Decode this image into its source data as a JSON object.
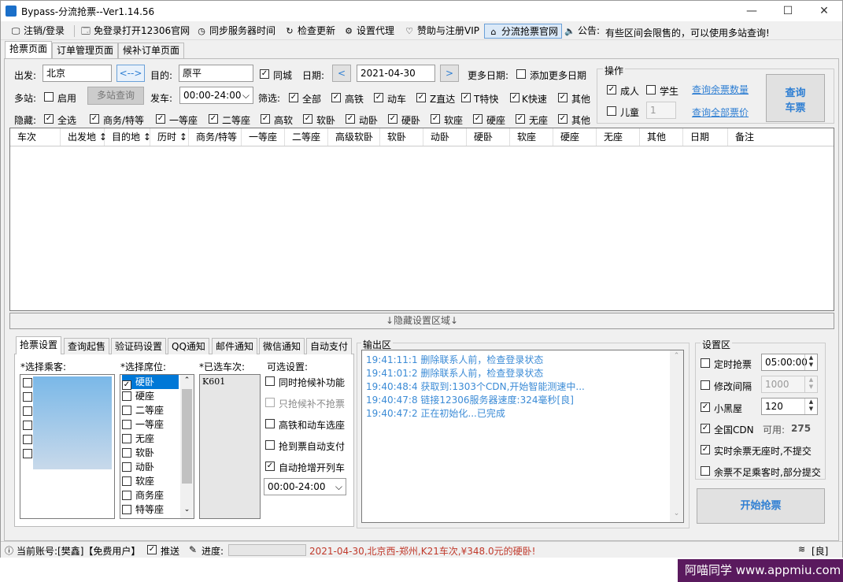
{
  "window": {
    "title": "Bypass-分流抢票--Ver1.14.56",
    "min": "—",
    "max": "☐",
    "close": "✕"
  },
  "menu": [
    {
      "label": "注销/登录",
      "icon": "🖵"
    },
    {
      "label": "免登录打开12306官网",
      "icon": "🗔"
    },
    {
      "label": "同步服务器时间",
      "icon": "◷"
    },
    {
      "label": "检查更新",
      "icon": "↻"
    },
    {
      "label": "设置代理",
      "icon": "⚙"
    },
    {
      "label": "赞助与注册VIP",
      "icon": "♡"
    },
    {
      "label": "分流抢票官网",
      "icon": "⌂"
    },
    {
      "label": "公告:",
      "icon": "🔈"
    }
  ],
  "notice": "有些区间会限售的，可以使用多站查询!",
  "tabs": [
    "抢票页面",
    "订单管理页面",
    "候补订单页面"
  ],
  "query": {
    "from_label": "出发:",
    "from": "北京",
    "swap": "<-->",
    "to_label": "目的:",
    "to": "原平",
    "same_city": "同城",
    "date_label": "日期:",
    "date": "2021-04-30",
    "prev": "<",
    "next": ">",
    "more_dates_label": "更多日期:",
    "add_more_dates": "添加更多日期",
    "multi_label": "多站:",
    "enable": "启用",
    "multi_query": "多站查询",
    "depart_label": "发车:",
    "depart_range": "00:00-24:00",
    "filter_label": "筛选:",
    "filters": [
      "全部",
      "高铁",
      "动车",
      "Z直达",
      "T特快",
      "K快速",
      "其他"
    ],
    "hide_label": "隐藏:",
    "hide_options": [
      "全选",
      "商务/特等",
      "一等座",
      "二等座",
      "高软",
      "软卧",
      "动卧",
      "硬卧",
      "软座",
      "硬座",
      "无座",
      "其他"
    ]
  },
  "ops": {
    "title": "操作",
    "adult": "成人",
    "student": "学生",
    "child": "儿童",
    "child_count": "1",
    "remain_count": "查询余票数量",
    "all_price": "查询全部票价",
    "query_btn_l1": "查询",
    "query_btn_l2": "车票"
  },
  "grid_headers": [
    "车次",
    "出发地 ↕",
    "目的地 ↕",
    "历时 ↕",
    "商务/特等",
    "一等座",
    "二等座",
    "高级软卧",
    "软卧",
    "动卧",
    "硬卧",
    "软座",
    "硬座",
    "无座",
    "其他",
    "日期",
    "备注"
  ],
  "hide_bar": "↓隐藏设置区域↓",
  "subtabs": [
    "抢票设置",
    "查询起售",
    "验证码设置",
    "QQ通知",
    "邮件通知",
    "微信通知",
    "自动支付"
  ],
  "passengers_label": "*选择乘客:",
  "seats_label": "*选择席位:",
  "seats": [
    "硬卧",
    "硬座",
    "二等座",
    "一等座",
    "无座",
    "软卧",
    "动卧",
    "软座",
    "商务座",
    "特等座"
  ],
  "chosen_label": "*已选车次:",
  "chosen": "K601",
  "options_label": "可选设置:",
  "options": [
    "同时抢候补功能",
    "只抢候补不抢票",
    "高铁和动车选座",
    "抢到票自动支付",
    "自动抢增开列车"
  ],
  "options_time": "00:00-24:00",
  "output_label": "输出区",
  "logs": [
    "19:41:11:1   删除联系人前，检查登录状态",
    "19:41:01:2   删除联系人前，检查登录状态",
    "19:40:48:4   获取到:1303个CDN,开始智能测速中...",
    "19:40:47:8   链接12306服务器速度:324毫秒[良]",
    "19:40:47:2   正在初始化...已完成"
  ],
  "settings": {
    "title": "设置区",
    "timed": "定时抢票",
    "timed_val": "05:00:00",
    "interval": "修改间隔",
    "interval_val": "1000",
    "blackroom": "小黑屋",
    "blackroom_val": "120",
    "cdn": "全国CDN",
    "cdn_avail": "可用:",
    "cdn_count": "275",
    "no_seat": "实时余票无座时,不提交",
    "partial": "余票不足乘客时,部分提交",
    "start": "开始抢票"
  },
  "status": {
    "account": "当前账号:[樊鑫]【免费用户】",
    "push": "推送",
    "progress": "进度:",
    "message": "2021-04-30,北京西-郑州,K21车次,¥348.0元的硬卧!",
    "signal": "[良]"
  },
  "watermark": "阿喵同学  www.appmiu.com"
}
